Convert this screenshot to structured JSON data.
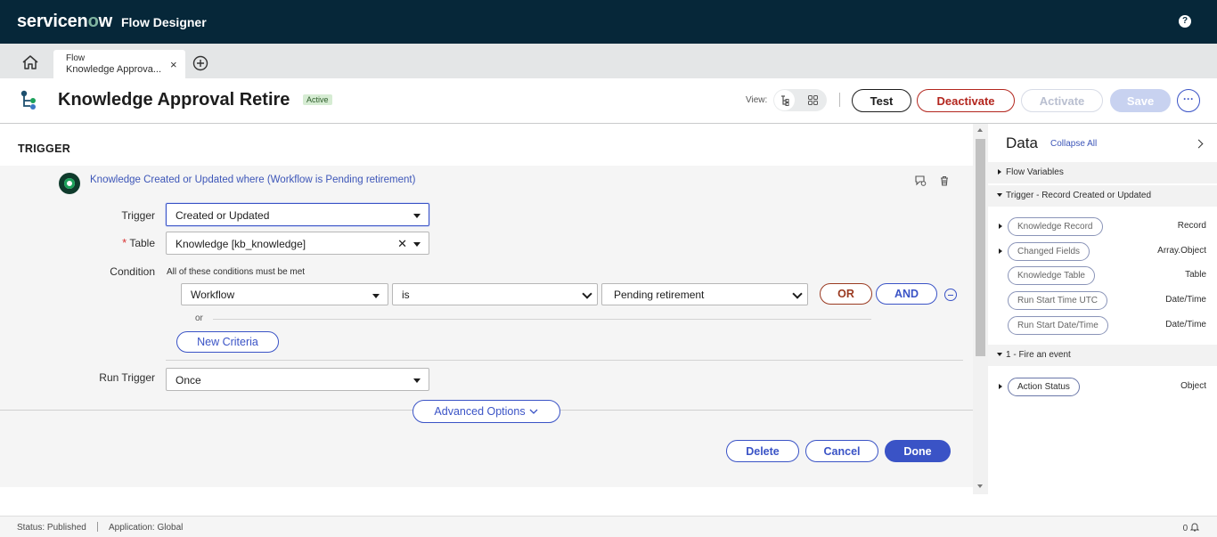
{
  "header": {
    "logo_text_a": "servicen",
    "logo_text_o": "o",
    "logo_text_b": "w",
    "app_name": "Flow Designer",
    "help_label": "?"
  },
  "tabs": {
    "items": [
      {
        "type": "Flow",
        "label": "Knowledge Approva..."
      }
    ],
    "close_glyph": "×"
  },
  "titlebar": {
    "title": "Knowledge Approval Retire",
    "status_badge": "Active",
    "view_label": "View:",
    "test_label": "Test",
    "deactivate_label": "Deactivate",
    "activate_label": "Activate",
    "save_label": "Save",
    "more_label": "···"
  },
  "trigger": {
    "section_title": "TRIGGER",
    "summary": "Knowledge Created or Updated where (Workflow is Pending retirement)",
    "trigger_label": "Trigger",
    "trigger_value": "Created or Updated",
    "required_mark": "*",
    "table_label": "Table",
    "table_value": "Knowledge [kb_knowledge]",
    "table_clear": "✕",
    "condition_label": "Condition",
    "condition_note": "All of these conditions must be met",
    "condition": {
      "field": "Workflow",
      "operator": "is",
      "value": "Pending retirement"
    },
    "or_label": "OR",
    "and_label": "AND",
    "or_separator": "or",
    "new_criteria_label": "New Criteria",
    "run_trigger_label": "Run Trigger",
    "run_trigger_value": "Once",
    "advanced_options_label": "Advanced Options",
    "delete_label": "Delete",
    "cancel_label": "Cancel",
    "done_label": "Done"
  },
  "data_panel": {
    "title": "Data",
    "collapse_all": "Collapse All",
    "sections": [
      {
        "label": "Flow Variables"
      },
      {
        "label": "Trigger - Record Created or Updated"
      },
      {
        "label": "1 - Fire an event"
      }
    ],
    "trigger_pills": [
      {
        "label": "Knowledge Record",
        "type": "Record"
      },
      {
        "label": "Changed Fields",
        "type": "Array.Object"
      },
      {
        "label": "Knowledge Table",
        "type": "Table"
      },
      {
        "label": "Run Start Time UTC",
        "type": "Date/Time"
      },
      {
        "label": "Run Start Date/Time",
        "type": "Date/Time"
      }
    ],
    "action_pills": [
      {
        "label": "Action Status",
        "type": "Object"
      }
    ]
  },
  "statusbar": {
    "status": "Status: Published",
    "application": "Application: Global",
    "notifications": "0"
  }
}
